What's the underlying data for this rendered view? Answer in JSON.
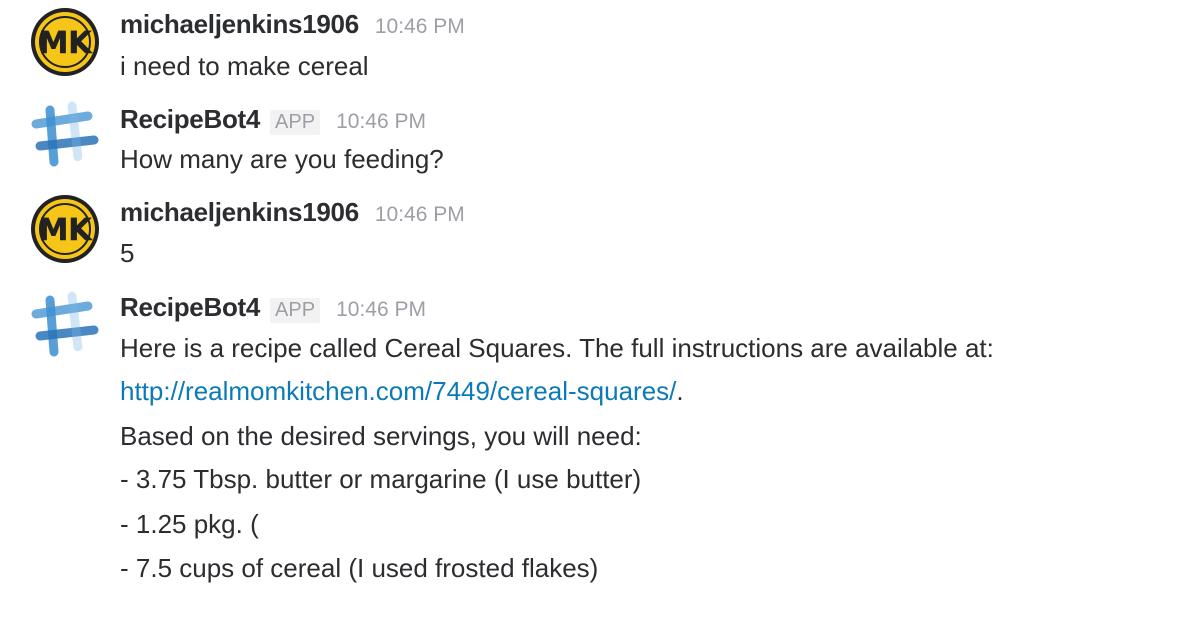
{
  "messages": [
    {
      "author": "michaeljenkins1906",
      "time": "10:46 PM",
      "avatar_icon": "mk-logo-avatar",
      "lines": [
        "i need to make cereal"
      ]
    },
    {
      "author": "RecipeBot4",
      "badge": "APP",
      "time": "10:46 PM",
      "avatar_icon": "recipebot-hashtag-avatar",
      "lines": [
        "How many are you feeding?"
      ]
    },
    {
      "author": "michaeljenkins1906",
      "time": "10:46 PM",
      "avatar_icon": "mk-logo-avatar",
      "lines": [
        "5"
      ]
    },
    {
      "author": "RecipeBot4",
      "badge": "APP",
      "time": "10:46 PM",
      "avatar_icon": "recipebot-hashtag-avatar",
      "lines": [
        "Here is a recipe called Cereal Squares. The full instructions are available at:",
        "Based on the desired servings, you will need:",
        "- 3.75 Tbsp. butter or margarine (I use butter)",
        "- 1.25 pkg.  (",
        "- 7.5 cups of cereal (I used frosted flakes)"
      ],
      "link": "http://realmomkitchen.com/7449/cereal-squares/",
      "link_suffix": "."
    }
  ],
  "colors": {
    "link": "#0b7ab8",
    "timestamp": "#9e9ea6",
    "mk_yellow": "#f5c518",
    "bot_blue": "#3d8fd1"
  }
}
